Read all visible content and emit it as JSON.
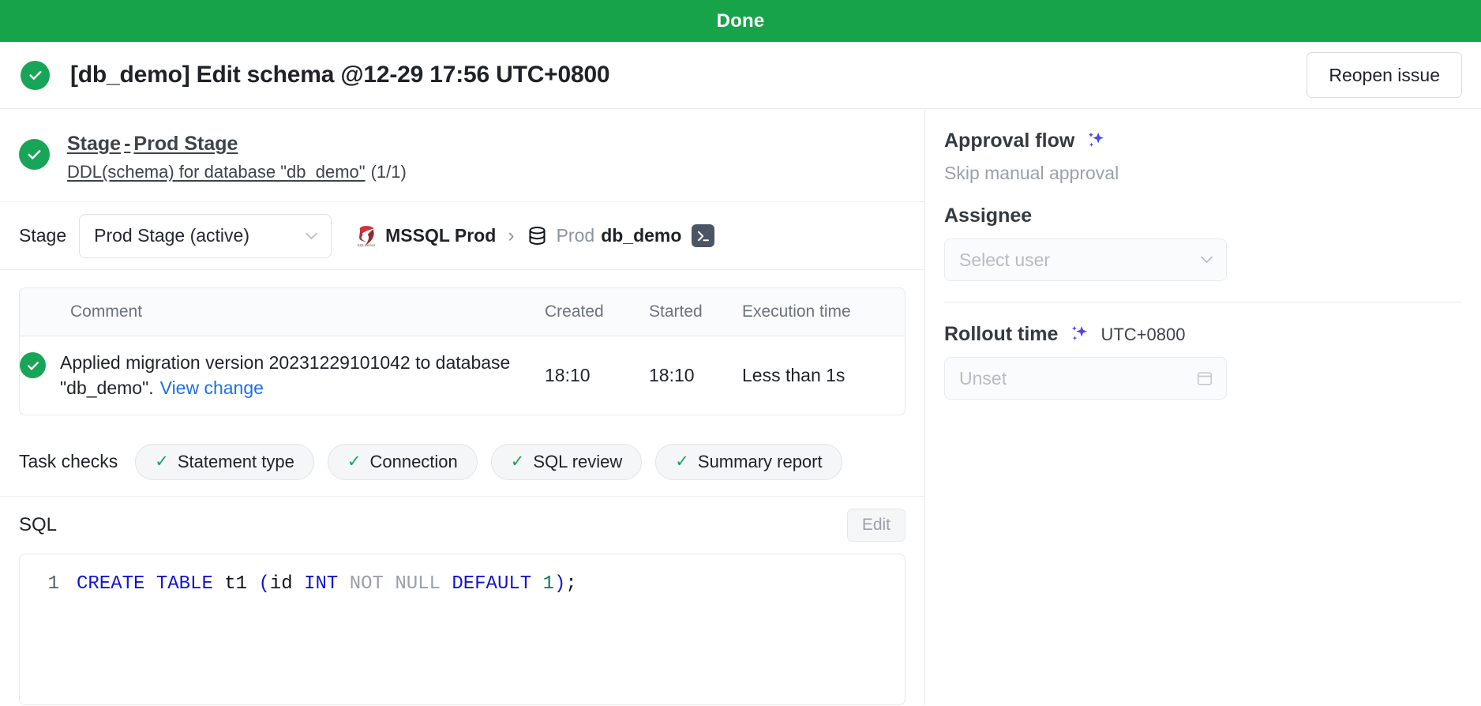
{
  "status_bar": {
    "label": "Done",
    "color": "#17a34a"
  },
  "header": {
    "title": "[db_demo] Edit schema @12-29 17:56 UTC+0800",
    "status_icon": "check-circle-icon",
    "reopen_label": "Reopen issue"
  },
  "stage_summary": {
    "line1_prefix": "Stage",
    "line1_dash": "-",
    "line1_stage": "Prod Stage",
    "line2_task": "DDL(schema) for database \"db_demo\"",
    "line2_count": "(1/1)"
  },
  "stage_row": {
    "label": "Stage",
    "selected": "Prod Stage (active)",
    "engine": "MSSQL Prod",
    "separator": "›",
    "db_env": "Prod",
    "db_name": "db_demo",
    "terminal_icon": "terminal-icon"
  },
  "task_table": {
    "columns": [
      "Comment",
      "Created",
      "Started",
      "Execution time"
    ],
    "rows": [
      {
        "status_icon": "check-circle-icon",
        "comment": "Applied migration version 20231229101042 to database \"db_demo\".",
        "link": "View change",
        "created": "18:10",
        "started": "18:10",
        "execution_time": "Less than 1s"
      }
    ]
  },
  "task_checks": {
    "label": "Task checks",
    "items": [
      {
        "label": "Statement type",
        "state": "pass",
        "tick": "✓"
      },
      {
        "label": "Connection",
        "state": "pass",
        "tick": "✓"
      },
      {
        "label": "SQL review",
        "state": "pass",
        "tick": "✓"
      },
      {
        "label": "Summary report",
        "state": "pass",
        "tick": "✓"
      }
    ]
  },
  "sql_section": {
    "title": "SQL",
    "edit_label": "Edit",
    "line_number": "1",
    "tokens": [
      {
        "t": "CREATE",
        "c": "kw"
      },
      {
        "t": " ",
        "c": "txt"
      },
      {
        "t": "TABLE",
        "c": "kw"
      },
      {
        "t": " t1 ",
        "c": "txt"
      },
      {
        "t": "(",
        "c": "pun"
      },
      {
        "t": "id ",
        "c": "txt"
      },
      {
        "t": "INT",
        "c": "kw"
      },
      {
        "t": " ",
        "c": "txt"
      },
      {
        "t": "NOT NULL",
        "c": "gray"
      },
      {
        "t": " ",
        "c": "txt"
      },
      {
        "t": "DEFAULT",
        "c": "kw"
      },
      {
        "t": " ",
        "c": "txt"
      },
      {
        "t": "1",
        "c": "num"
      },
      {
        "t": ")",
        "c": "pun"
      },
      {
        "t": ";",
        "c": "semi"
      }
    ],
    "plain": "CREATE TABLE t1 (id INT NOT NULL DEFAULT 1);"
  },
  "sidebar": {
    "approval_flow": {
      "title": "Approval flow",
      "ai_icon": "sparkle-icon",
      "subtitle": "Skip manual approval"
    },
    "assignee": {
      "label": "Assignee",
      "placeholder": "Select user"
    },
    "rollout_time": {
      "label": "Rollout time",
      "ai_icon": "sparkle-icon",
      "timezone": "UTC+0800",
      "placeholder": "Unset",
      "calendar_icon": "calendar-icon"
    }
  },
  "colors": {
    "success": "#18a558",
    "status_bar": "#17a34a",
    "link": "#1f6feb",
    "accent_ai": "#4f46e5",
    "keyword": "#1515cf",
    "number": "#0a7a52",
    "muted": "#9aa1a9"
  }
}
